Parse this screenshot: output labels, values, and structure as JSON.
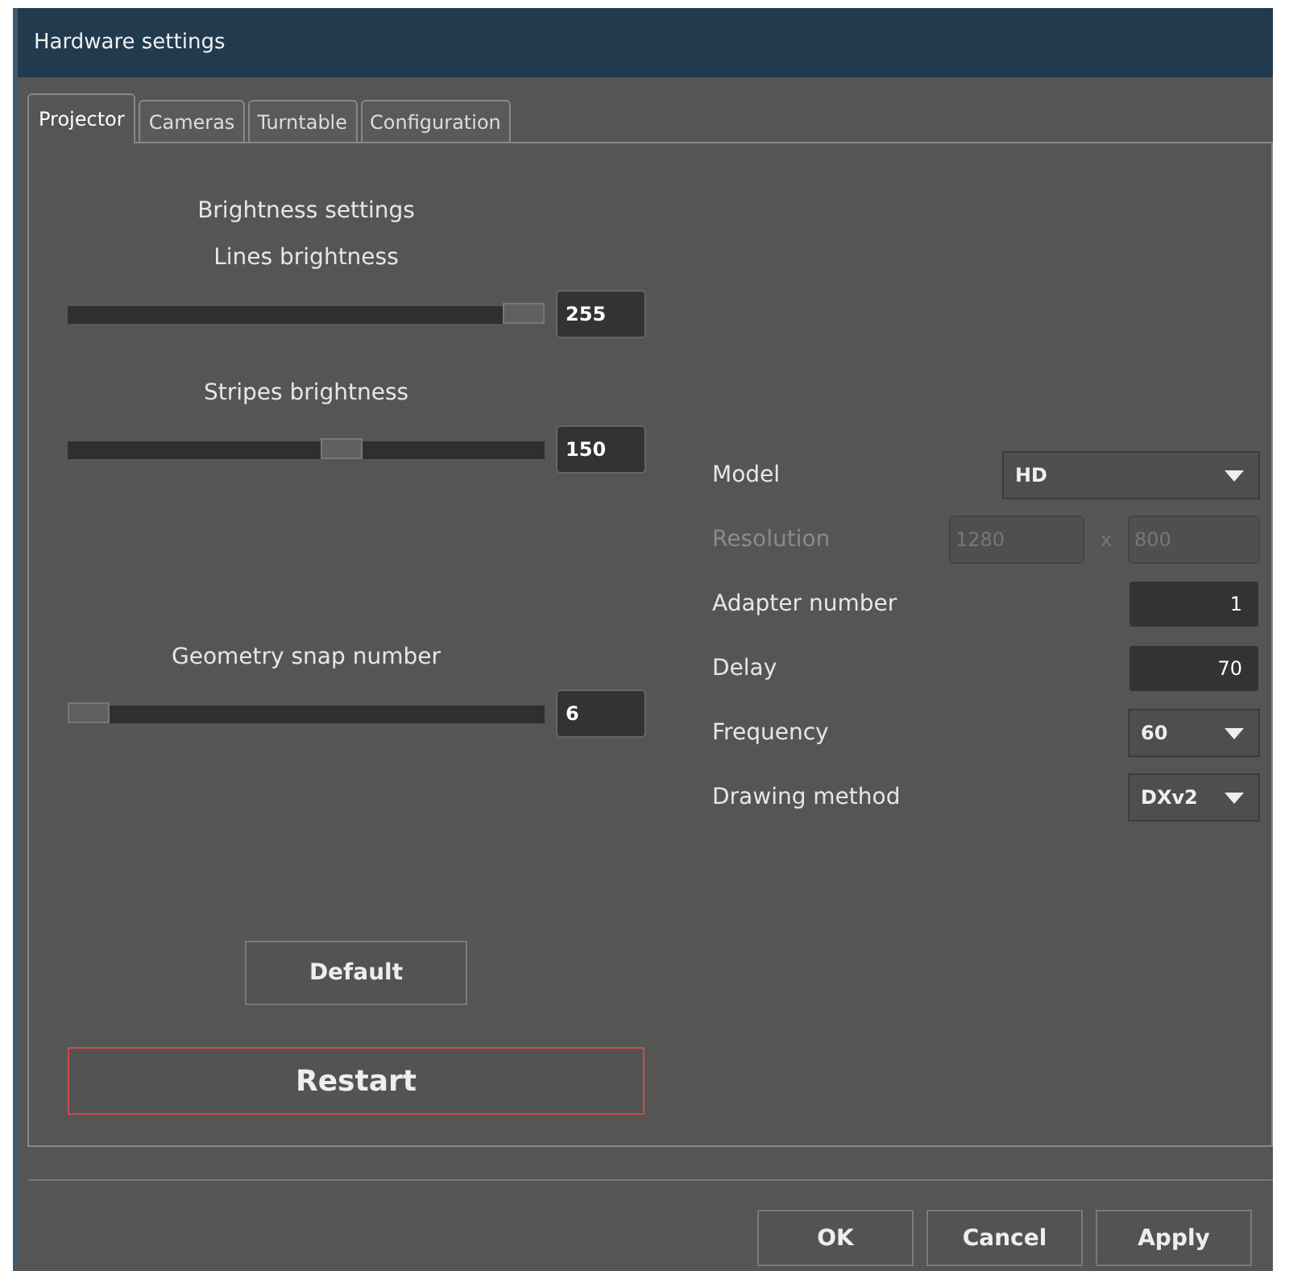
{
  "window": {
    "title": "Hardware settings"
  },
  "tabs": [
    {
      "label": "Projector",
      "selected": true
    },
    {
      "label": "Cameras",
      "selected": false
    },
    {
      "label": "Turntable",
      "selected": false
    },
    {
      "label": "Configuration",
      "selected": false
    }
  ],
  "brightness": {
    "heading": "Brightness settings",
    "sliders": [
      {
        "label": "Lines brightness",
        "level": 1.0,
        "value": "255"
      },
      {
        "label": "Stripes brightness",
        "level": 0.58,
        "value": "150"
      }
    ]
  },
  "geometry": {
    "label": "Geometry snap number",
    "level": 0.0,
    "value": "6"
  },
  "settings": [
    {
      "kind": "dropdown",
      "label": "Model",
      "value": "HD",
      "wide": true,
      "disabled": false
    },
    {
      "kind": "pair",
      "label": "Resolution",
      "value": "1280",
      "separator": "x",
      "value2": "800",
      "disabled": true
    },
    {
      "kind": "field",
      "label": "Adapter number",
      "value": "1",
      "disabled": false
    },
    {
      "kind": "field",
      "label": "Delay",
      "value": "70",
      "disabled": false
    },
    {
      "kind": "dropdown",
      "label": "Frequency",
      "value": "60",
      "wide": false,
      "disabled": false
    },
    {
      "kind": "dropdown",
      "label": "Drawing method",
      "value": "DXv2",
      "wide": false,
      "disabled": false
    }
  ],
  "default_button": "Default",
  "restart_button": "Restart",
  "buttons": [
    "OK",
    "Cancel",
    "Apply"
  ]
}
